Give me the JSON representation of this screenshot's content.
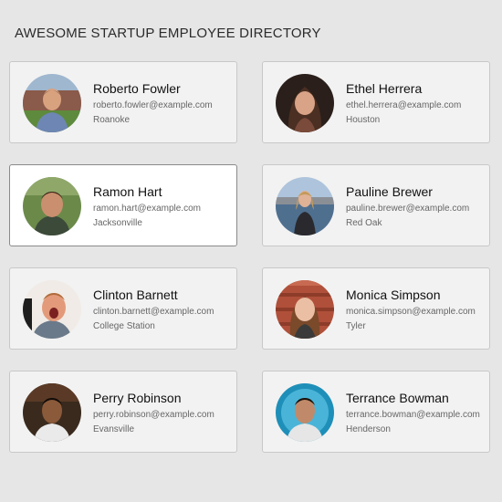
{
  "header": {
    "title": "AWESOME STARTUP EMPLOYEE DIRECTORY"
  },
  "employees": [
    {
      "name": "Roberto Fowler",
      "email": "roberto.fowler@example.com",
      "city": "Roanoke"
    },
    {
      "name": "Ethel Herrera",
      "email": "ethel.herrera@example.com",
      "city": "Houston"
    },
    {
      "name": "Ramon Hart",
      "email": "ramon.hart@example.com",
      "city": "Jacksonville"
    },
    {
      "name": "Pauline Brewer",
      "email": "pauline.brewer@example.com",
      "city": "Red Oak"
    },
    {
      "name": "Clinton Barnett",
      "email": "clinton.barnett@example.com",
      "city": "College Station"
    },
    {
      "name": "Monica Simpson",
      "email": "monica.simpson@example.com",
      "city": "Tyler"
    },
    {
      "name": "Perry Robinson",
      "email": "perry.robinson@example.com",
      "city": "Evansville"
    },
    {
      "name": "Terrance Bowman",
      "email": "terrance.bowman@example.com",
      "city": "Henderson"
    }
  ],
  "colors": {
    "page_background": "#e6e6e6",
    "card_background": "#f2f2f2",
    "card_selected_background": "#ffffff",
    "card_border": "#c8c8c8",
    "card_selected_border": "#8a8a8a"
  }
}
